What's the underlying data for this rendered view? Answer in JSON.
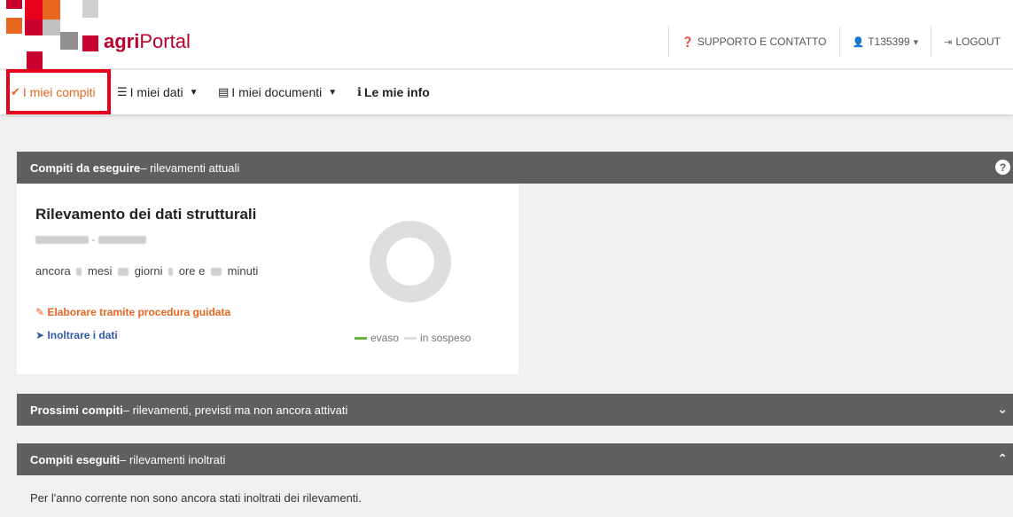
{
  "header": {
    "logo_bold": "agri",
    "logo_regular": "Portal",
    "support_label": "SUPPORTO E CONTATTO",
    "user_label": "T135399",
    "logout_label": "LOGOUT"
  },
  "nav": {
    "items": [
      {
        "label": "I miei compiti",
        "icon": "check-circle-icon",
        "active": true
      },
      {
        "label": "I miei dati",
        "icon": "list-icon"
      },
      {
        "label": "I miei documenti",
        "icon": "document-icon"
      },
      {
        "label": "Le mie info",
        "icon": "info-icon"
      }
    ]
  },
  "panels": {
    "current": {
      "title_bold": "Compiti da eseguire",
      "title_rest": " – rilevamenti attuali"
    },
    "upcoming": {
      "title_bold": "Prossimi compiti",
      "title_rest": " – rilevamenti, previsti ma non ancora attivati"
    },
    "done": {
      "title_bold": "Compiti eseguiti",
      "title_rest": " – rilevamenti inoltrati"
    }
  },
  "card": {
    "title": "Rilevamento dei dati strutturali",
    "remaining": {
      "prefix": "ancora",
      "months_label": "mesi",
      "days_label": "giorni",
      "hours_label": "ore e",
      "minutes_label": "minuti"
    },
    "action_edit": "Elaborare tramite procedura guidata",
    "action_send": "Inoltrare i dati",
    "legend_done": "evaso",
    "legend_pending": "in sospeso",
    "progress_done_fraction": 0
  },
  "done_message": "Per l'anno corrente non sono ancora stati inoltrati dei rilevamenti.",
  "colors": {
    "accent": "#e8661f",
    "brand": "#b8002a",
    "link_blue": "#2e5aa8",
    "legend_done": "#6cb33f",
    "legend_pending": "#dddddd"
  }
}
